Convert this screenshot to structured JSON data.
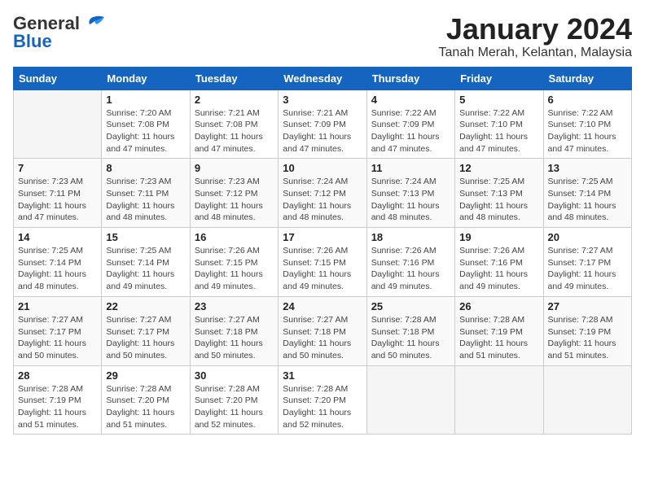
{
  "logo": {
    "line1": "General",
    "line2": "Blue"
  },
  "title": "January 2024",
  "subtitle": "Tanah Merah, Kelantan, Malaysia",
  "days_header": [
    "Sunday",
    "Monday",
    "Tuesday",
    "Wednesday",
    "Thursday",
    "Friday",
    "Saturday"
  ],
  "weeks": [
    [
      {
        "num": "",
        "info": ""
      },
      {
        "num": "1",
        "info": "Sunrise: 7:20 AM\nSunset: 7:08 PM\nDaylight: 11 hours\nand 47 minutes."
      },
      {
        "num": "2",
        "info": "Sunrise: 7:21 AM\nSunset: 7:08 PM\nDaylight: 11 hours\nand 47 minutes."
      },
      {
        "num": "3",
        "info": "Sunrise: 7:21 AM\nSunset: 7:09 PM\nDaylight: 11 hours\nand 47 minutes."
      },
      {
        "num": "4",
        "info": "Sunrise: 7:22 AM\nSunset: 7:09 PM\nDaylight: 11 hours\nand 47 minutes."
      },
      {
        "num": "5",
        "info": "Sunrise: 7:22 AM\nSunset: 7:10 PM\nDaylight: 11 hours\nand 47 minutes."
      },
      {
        "num": "6",
        "info": "Sunrise: 7:22 AM\nSunset: 7:10 PM\nDaylight: 11 hours\nand 47 minutes."
      }
    ],
    [
      {
        "num": "7",
        "info": "Sunrise: 7:23 AM\nSunset: 7:11 PM\nDaylight: 11 hours\nand 47 minutes."
      },
      {
        "num": "8",
        "info": "Sunrise: 7:23 AM\nSunset: 7:11 PM\nDaylight: 11 hours\nand 48 minutes."
      },
      {
        "num": "9",
        "info": "Sunrise: 7:23 AM\nSunset: 7:12 PM\nDaylight: 11 hours\nand 48 minutes."
      },
      {
        "num": "10",
        "info": "Sunrise: 7:24 AM\nSunset: 7:12 PM\nDaylight: 11 hours\nand 48 minutes."
      },
      {
        "num": "11",
        "info": "Sunrise: 7:24 AM\nSunset: 7:13 PM\nDaylight: 11 hours\nand 48 minutes."
      },
      {
        "num": "12",
        "info": "Sunrise: 7:25 AM\nSunset: 7:13 PM\nDaylight: 11 hours\nand 48 minutes."
      },
      {
        "num": "13",
        "info": "Sunrise: 7:25 AM\nSunset: 7:14 PM\nDaylight: 11 hours\nand 48 minutes."
      }
    ],
    [
      {
        "num": "14",
        "info": "Sunrise: 7:25 AM\nSunset: 7:14 PM\nDaylight: 11 hours\nand 48 minutes."
      },
      {
        "num": "15",
        "info": "Sunrise: 7:25 AM\nSunset: 7:14 PM\nDaylight: 11 hours\nand 49 minutes."
      },
      {
        "num": "16",
        "info": "Sunrise: 7:26 AM\nSunset: 7:15 PM\nDaylight: 11 hours\nand 49 minutes."
      },
      {
        "num": "17",
        "info": "Sunrise: 7:26 AM\nSunset: 7:15 PM\nDaylight: 11 hours\nand 49 minutes."
      },
      {
        "num": "18",
        "info": "Sunrise: 7:26 AM\nSunset: 7:16 PM\nDaylight: 11 hours\nand 49 minutes."
      },
      {
        "num": "19",
        "info": "Sunrise: 7:26 AM\nSunset: 7:16 PM\nDaylight: 11 hours\nand 49 minutes."
      },
      {
        "num": "20",
        "info": "Sunrise: 7:27 AM\nSunset: 7:17 PM\nDaylight: 11 hours\nand 49 minutes."
      }
    ],
    [
      {
        "num": "21",
        "info": "Sunrise: 7:27 AM\nSunset: 7:17 PM\nDaylight: 11 hours\nand 50 minutes."
      },
      {
        "num": "22",
        "info": "Sunrise: 7:27 AM\nSunset: 7:17 PM\nDaylight: 11 hours\nand 50 minutes."
      },
      {
        "num": "23",
        "info": "Sunrise: 7:27 AM\nSunset: 7:18 PM\nDaylight: 11 hours\nand 50 minutes."
      },
      {
        "num": "24",
        "info": "Sunrise: 7:27 AM\nSunset: 7:18 PM\nDaylight: 11 hours\nand 50 minutes."
      },
      {
        "num": "25",
        "info": "Sunrise: 7:28 AM\nSunset: 7:18 PM\nDaylight: 11 hours\nand 50 minutes."
      },
      {
        "num": "26",
        "info": "Sunrise: 7:28 AM\nSunset: 7:19 PM\nDaylight: 11 hours\nand 51 minutes."
      },
      {
        "num": "27",
        "info": "Sunrise: 7:28 AM\nSunset: 7:19 PM\nDaylight: 11 hours\nand 51 minutes."
      }
    ],
    [
      {
        "num": "28",
        "info": "Sunrise: 7:28 AM\nSunset: 7:19 PM\nDaylight: 11 hours\nand 51 minutes."
      },
      {
        "num": "29",
        "info": "Sunrise: 7:28 AM\nSunset: 7:20 PM\nDaylight: 11 hours\nand 51 minutes."
      },
      {
        "num": "30",
        "info": "Sunrise: 7:28 AM\nSunset: 7:20 PM\nDaylight: 11 hours\nand 52 minutes."
      },
      {
        "num": "31",
        "info": "Sunrise: 7:28 AM\nSunset: 7:20 PM\nDaylight: 11 hours\nand 52 minutes."
      },
      {
        "num": "",
        "info": ""
      },
      {
        "num": "",
        "info": ""
      },
      {
        "num": "",
        "info": ""
      }
    ]
  ]
}
